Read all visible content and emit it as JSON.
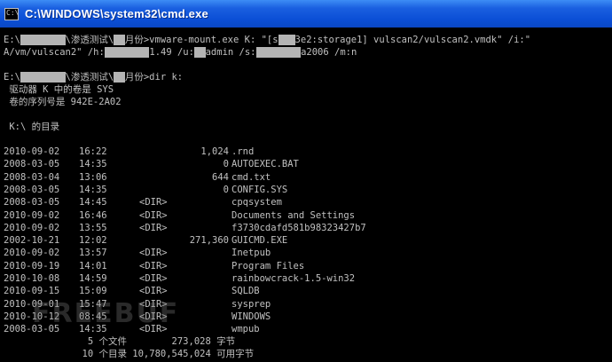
{
  "window": {
    "title": "C:\\WINDOWS\\system32\\cmd.exe",
    "icon_label": "C:\\"
  },
  "console": {
    "cmd1": {
      "p1": "E:\\",
      "p2": "\\渗透测试\\",
      "p3": "月份>vmware-mount.exe K: \"[s",
      "p4": "3e2:storage1] vulscan2/vulscan2.vmdk\" /i:\"",
      "wrap_p1": "A/vm/vulscan2\" /h:",
      "wrap_p2": "1.49 /u:",
      "wrap_p3": "admin /s:",
      "wrap_p4": "a2006 /m:n"
    },
    "cmd2": {
      "p1": "E:\\",
      "p2": "\\渗透测试\\",
      "p3": "月份>dir k:"
    },
    "volume_line": " 驱动器 K 中的卷是 SYS",
    "serial_line": " 卷的序列号是 942E-2A02",
    "dir_header": " K:\\ 的目录",
    "entries": [
      {
        "date": "2010-09-02",
        "time": "16:22",
        "dir": "",
        "size": "1,024",
        "name": ".rnd"
      },
      {
        "date": "2008-03-05",
        "time": "14:35",
        "dir": "",
        "size": "0",
        "name": "AUTOEXEC.BAT"
      },
      {
        "date": "2008-03-04",
        "time": "13:06",
        "dir": "",
        "size": "644",
        "name": "cmd.txt"
      },
      {
        "date": "2008-03-05",
        "time": "14:35",
        "dir": "",
        "size": "0",
        "name": "CONFIG.SYS"
      },
      {
        "date": "2008-03-05",
        "time": "14:45",
        "dir": "<DIR>",
        "size": "",
        "name": "cpqsystem"
      },
      {
        "date": "2010-09-02",
        "time": "16:46",
        "dir": "<DIR>",
        "size": "",
        "name": "Documents and Settings"
      },
      {
        "date": "2010-09-02",
        "time": "13:55",
        "dir": "<DIR>",
        "size": "",
        "name": "f3730cdafd581b98323427b7"
      },
      {
        "date": "2002-10-21",
        "time": "12:02",
        "dir": "",
        "size": "271,360",
        "name": "GUICMD.EXE"
      },
      {
        "date": "2010-09-02",
        "time": "13:57",
        "dir": "<DIR>",
        "size": "",
        "name": "Inetpub"
      },
      {
        "date": "2010-09-19",
        "time": "14:01",
        "dir": "<DIR>",
        "size": "",
        "name": "Program Files"
      },
      {
        "date": "2010-10-08",
        "time": "14:59",
        "dir": "<DIR>",
        "size": "",
        "name": "rainbowcrack-1.5-win32"
      },
      {
        "date": "2010-09-15",
        "time": "15:09",
        "dir": "<DIR>",
        "size": "",
        "name": "SQLDB"
      },
      {
        "date": "2010-09-01",
        "time": "15:47",
        "dir": "<DIR>",
        "size": "",
        "name": "sysprep"
      },
      {
        "date": "2010-10-12",
        "time": "08:45",
        "dir": "<DIR>",
        "size": "",
        "name": "WINDOWS"
      },
      {
        "date": "2008-03-05",
        "time": "14:35",
        "dir": "<DIR>",
        "size": "",
        "name": "wmpub"
      }
    ],
    "summary_files": "               5 个文件        273,028 字节",
    "summary_dirs": "              10 个目录 10,780,545,024 可用字节"
  },
  "watermark": "FREEBUF",
  "colors": {
    "console_bg": "#000000",
    "console_text": "#c0c0c0",
    "titlebar": "#0b4fd6",
    "redaction": "#b4b4b4"
  }
}
